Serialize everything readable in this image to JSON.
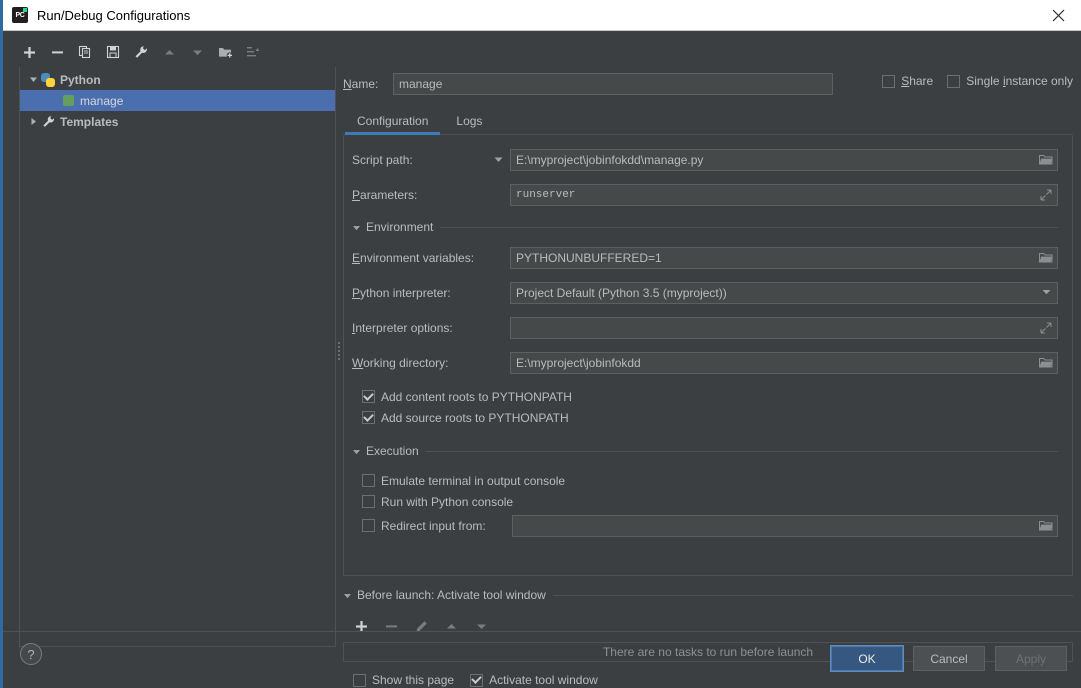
{
  "window": {
    "title": "Run/Debug Configurations",
    "app_icon": "pycharm-icon",
    "close_icon": "close-icon"
  },
  "toolbar": {
    "items": [
      {
        "name": "add-configuration-button",
        "icon": "plus-icon",
        "enabled": true
      },
      {
        "name": "remove-configuration-button",
        "icon": "minus-icon",
        "enabled": true
      },
      {
        "name": "copy-configuration-button",
        "icon": "copy-icon",
        "enabled": true
      },
      {
        "name": "save-configuration-button",
        "icon": "save-icon",
        "enabled": true
      },
      {
        "name": "edit-templates-button",
        "icon": "wrench-icon",
        "enabled": true
      },
      {
        "name": "move-up-button",
        "icon": "arrow-up-icon",
        "enabled": false
      },
      {
        "name": "move-down-button",
        "icon": "arrow-down-icon",
        "enabled": false
      },
      {
        "name": "move-into-folder-button",
        "icon": "folder-add-icon",
        "enabled": true
      },
      {
        "name": "sort-configurations-button",
        "icon": "sort-icon",
        "enabled": false
      }
    ]
  },
  "tree": {
    "nodes": [
      {
        "label": "Python",
        "icon": "python-logo-icon",
        "expanded": true,
        "bold": true,
        "selected": false,
        "level": 0
      },
      {
        "label": "manage",
        "icon": "python-script-icon",
        "expanded": null,
        "bold": false,
        "selected": true,
        "level": 1
      },
      {
        "label": "Templates",
        "icon": "wrench-icon",
        "expanded": false,
        "bold": true,
        "selected": false,
        "level": 0
      }
    ]
  },
  "form": {
    "name_label": "Name:",
    "name_value": "manage",
    "share": {
      "label": "Share",
      "checked": false
    },
    "single_instance": {
      "label": "Single instance only",
      "checked": false
    }
  },
  "tabs": [
    {
      "label": "Configuration",
      "active": true
    },
    {
      "label": "Logs",
      "active": false
    }
  ],
  "configuration": {
    "script_path": {
      "label": "Script path:",
      "value": "E:\\myproject\\jobinfokdd\\manage.py",
      "browse_icon": "folder-browse-icon",
      "has_dropdown": true
    },
    "parameters": {
      "label": "Parameters:",
      "value": "runserver",
      "expand_icon": "expand-editor-icon"
    },
    "environment_section": {
      "label": "Environment",
      "expanded": true
    },
    "environment_variables": {
      "label": "Environment variables:",
      "value": "PYTHONUNBUFFERED=1",
      "browse_icon": "folder-browse-icon"
    },
    "python_interpreter": {
      "label": "Python interpreter:",
      "value": "Project Default (Python 3.5 (myproject))",
      "dropdown_icon": "chevron-down-icon"
    },
    "interpreter_options": {
      "label": "Interpreter options:",
      "value": "",
      "expand_icon": "expand-editor-icon"
    },
    "working_directory": {
      "label": "Working directory:",
      "value": "E:\\myproject\\jobinfokdd",
      "browse_icon": "folder-browse-icon"
    },
    "add_content_roots": {
      "label": "Add content roots to PYTHONPATH",
      "checked": true
    },
    "add_source_roots": {
      "label": "Add source roots to PYTHONPATH",
      "checked": true
    },
    "execution_section": {
      "label": "Execution",
      "expanded": true
    },
    "emulate_terminal": {
      "label": "Emulate terminal in output console",
      "checked": false
    },
    "run_with_python_console": {
      "label": "Run with Python console",
      "checked": false
    },
    "redirect_input": {
      "label": "Redirect input from:",
      "checked": false,
      "value": "",
      "browse_icon": "folder-browse-icon"
    }
  },
  "before_launch": {
    "section_label": "Before launch: Activate tool window",
    "expanded": true,
    "toolbar": [
      {
        "name": "add-task-button",
        "icon": "plus-icon",
        "enabled": true
      },
      {
        "name": "remove-task-button",
        "icon": "minus-icon",
        "enabled": false
      },
      {
        "name": "edit-task-button",
        "icon": "pencil-icon",
        "enabled": false
      },
      {
        "name": "task-move-up-button",
        "icon": "arrow-up-icon",
        "enabled": false
      },
      {
        "name": "task-move-down-button",
        "icon": "arrow-down-icon",
        "enabled": false
      }
    ],
    "empty_text": "There are no tasks to run before launch",
    "show_this_page": {
      "label": "Show this page",
      "checked": false
    },
    "activate_tool_window": {
      "label": "Activate tool window",
      "checked": true
    }
  },
  "footer": {
    "help_label": "?",
    "ok_label": "OK",
    "cancel_label": "Cancel",
    "apply_label": "Apply",
    "apply_enabled": false
  },
  "colors": {
    "background": "#3c3f41",
    "input_background": "#45494a",
    "border": "#4e5254",
    "selection": "#4b6eaf",
    "accent": "#3d7ab8",
    "primary_button": "#365880",
    "text": "#bbbbbb",
    "titlebar": "#ffffff"
  }
}
